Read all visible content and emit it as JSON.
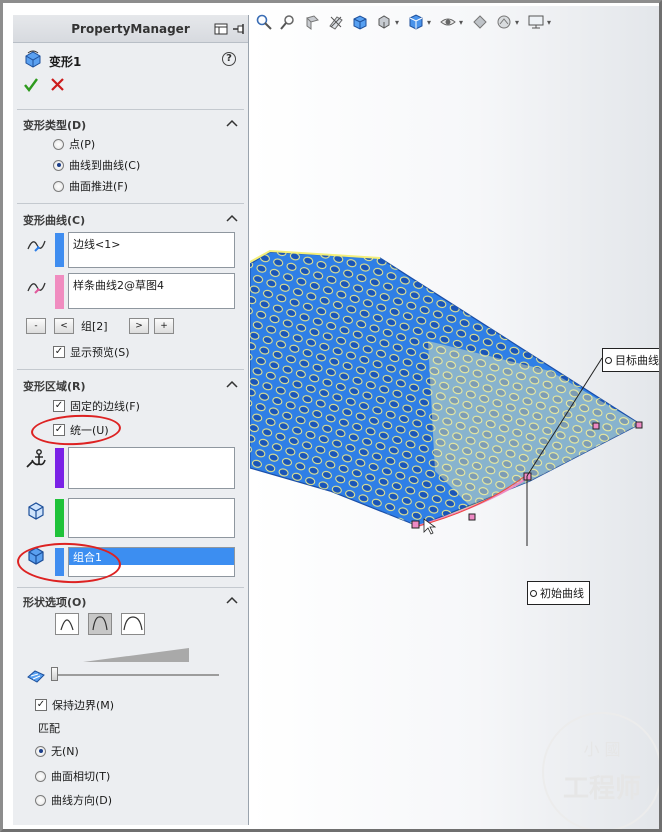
{
  "panel": {
    "header_title": "PropertyManager",
    "feature_name": "变形1"
  },
  "deform_type": {
    "title": "变形类型(D)",
    "options": [
      "点(P)",
      "曲线到曲线(C)",
      "曲面推进(F)"
    ],
    "selected": "曲线到曲线(C)"
  },
  "deform_curves": {
    "title": "变形曲线(C)",
    "initial_curve": "边线<1>",
    "target_curve": "样条曲线2@草图4",
    "group_label": "组[2]",
    "btn_minus": "-",
    "btn_prev": "<",
    "btn_next": ">",
    "btn_plus": "+",
    "show_preview": "显示预览(S)"
  },
  "deform_region": {
    "title": "变形区域(R)",
    "fixed_edges": "固定的边线(F)",
    "uniform": "统一(U)",
    "body_value": "组合1"
  },
  "shape_options": {
    "title": "形状选项(O)",
    "keep_boundary": "保持边界(M)",
    "match_label": "匹配",
    "match_options": [
      "无(N)",
      "曲面相切(T)",
      "曲线方向(D)"
    ],
    "match_selected": "无(N)"
  },
  "viewport": {
    "callout_target": "目标曲线",
    "callout_initial": "初始曲线",
    "watermark_top": "小 國",
    "watermark_bottom": "工程师"
  },
  "colors": {
    "initial_curve_bar": "#3f8df0",
    "target_curve_bar": "#f08cc0",
    "fixed_edges_bar": "#7a22e6",
    "faces_bar": "#1fc23a",
    "body_bar": "#3f8df0",
    "part_blue": "#2f7fe6",
    "highlight_yellow": "#f4ef7a",
    "annotation_red": "#dd2222"
  }
}
